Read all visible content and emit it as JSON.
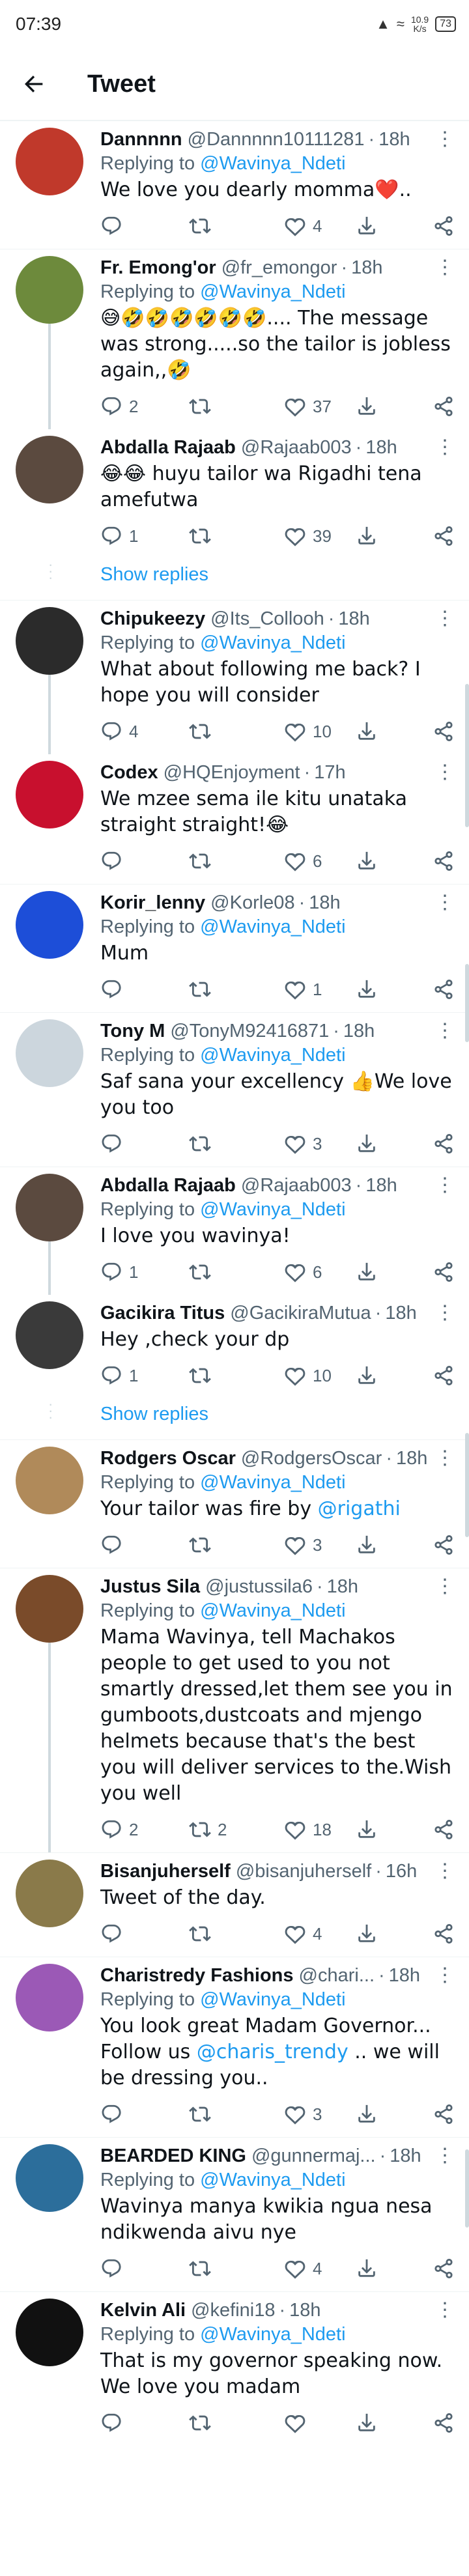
{
  "status_bar": {
    "time": "07:39",
    "net_speed": "10.9",
    "net_unit": "K/s",
    "battery": "73"
  },
  "header": {
    "title": "Tweet"
  },
  "common": {
    "replying_label": "Replying to",
    "show_replies": "Show replies"
  },
  "tweets": [
    {
      "name": "Dannnnn",
      "handle": "@Dannnnn10111281",
      "time": "18h",
      "reply_to": "@Wavinya_Ndeti",
      "text": "We love you dearly momma❤️..",
      "replies": "",
      "retweets": "",
      "likes": "4",
      "avatar": "#c0392b"
    },
    {
      "name": "Fr. Emong'or",
      "handle": "@fr_emongor",
      "time": "18h",
      "reply_to": "@Wavinya_Ndeti",
      "text": "😅🤣🤣🤣🤣🤣🤣.... The message was strong.....so the tailor is jobless again,,🤣",
      "replies": "2",
      "retweets": "",
      "likes": "37",
      "avatar": "#6d8a3c"
    },
    {
      "name": "Abdalla Rajaab",
      "handle": "@Rajaab003",
      "time": "18h",
      "reply_to": "",
      "text": "😂😂 huyu tailor wa Rigadhi tena amefutwa",
      "replies": "1",
      "retweets": "",
      "likes": "39",
      "avatar": "#5b4a3f"
    },
    {
      "name": "Chipukeezy",
      "handle": "@Its_Collooh",
      "time": "18h",
      "reply_to": "@Wavinya_Ndeti",
      "text": "What about following me back? I hope you will consider",
      "replies": "4",
      "retweets": "",
      "likes": "10",
      "avatar": "#2b2b2b"
    },
    {
      "name": "Codex",
      "handle": "@HQEnjoyment",
      "time": "17h",
      "reply_to": "",
      "text": "We mzee sema ile kitu unataka straight straight!😂",
      "replies": "",
      "retweets": "",
      "likes": "6",
      "avatar": "#c8102e"
    },
    {
      "name": "Korir_lenny",
      "handle": "@Korle08",
      "time": "18h",
      "reply_to": "@Wavinya_Ndeti",
      "text": "Mum",
      "replies": "",
      "retweets": "",
      "likes": "1",
      "avatar": "#1d4ed8"
    },
    {
      "name": "Tony M",
      "handle": "@TonyM92416871",
      "time": "18h",
      "reply_to": "@Wavinya_Ndeti",
      "text": "Saf sana your excellency 👍We love you too",
      "replies": "",
      "retweets": "",
      "likes": "3",
      "avatar": "#ccd6dd"
    },
    {
      "name": "Abdalla Rajaab",
      "handle": "@Rajaab003",
      "time": "18h",
      "reply_to": "@Wavinya_Ndeti",
      "text": "I love you wavinya!",
      "replies": "1",
      "retweets": "",
      "likes": "6",
      "avatar": "#5b4a3f"
    },
    {
      "name": "Gacikira Titus",
      "handle": "@GacikiraMutua",
      "time": "18h",
      "reply_to": "",
      "text": "Hey ,check your dp",
      "replies": "1",
      "retweets": "",
      "likes": "10",
      "avatar": "#3a3a3a"
    },
    {
      "name": "Rodgers Oscar",
      "handle": "@RodgersOscar",
      "time": "18h",
      "reply_to": "@Wavinya_Ndeti",
      "text": "Your tailor was fire by ",
      "text_mention": "@rigathi",
      "replies": "",
      "retweets": "",
      "likes": "3",
      "avatar": "#b08a5a"
    },
    {
      "name": "Justus Sila",
      "handle": "@justussila6",
      "time": "18h",
      "reply_to": "@Wavinya_Ndeti",
      "text": "Mama Wavinya, tell Machakos people to get used to you not smartly dressed,let them see you in gumboots,dustcoats and mjengo helmets because that's the best you will deliver services to the.Wish you well",
      "replies": "2",
      "retweets": "2",
      "likes": "18",
      "avatar": "#7a4b2a"
    },
    {
      "name": "Bisanjuherself",
      "handle": "@bisanjuherself",
      "time": "16h",
      "reply_to": "",
      "text": "Tweet of the day.",
      "replies": "",
      "retweets": "",
      "likes": "4",
      "avatar": "#8a7a4a"
    },
    {
      "name": "Charistredy Fashions",
      "handle": "@chari...",
      "time": "18h",
      "reply_to": "@Wavinya_Ndeti",
      "text": "You look great Madam Governor... Follow us ",
      "text_mention": "@charis_trendy",
      "text_after": " .. we will be dressing you..",
      "replies": "",
      "retweets": "",
      "likes": "3",
      "avatar": "#9b59b6"
    },
    {
      "name": "BEARDED KING",
      "handle": "@gunnermaj...",
      "time": "18h",
      "reply_to": "@Wavinya_Ndeti",
      "text": "Wavinya manya kwikia ngua nesa ndikwenda aivu nye",
      "replies": "",
      "retweets": "",
      "likes": "4",
      "avatar": "#2c6e9b"
    },
    {
      "name": "Kelvin Ali",
      "handle": "@kefini18",
      "time": "18h",
      "reply_to": "@Wavinya_Ndeti",
      "text": "That is my governor speaking now. We love you madam",
      "replies": "",
      "retweets": "",
      "likes": "",
      "avatar": "#111111"
    }
  ]
}
